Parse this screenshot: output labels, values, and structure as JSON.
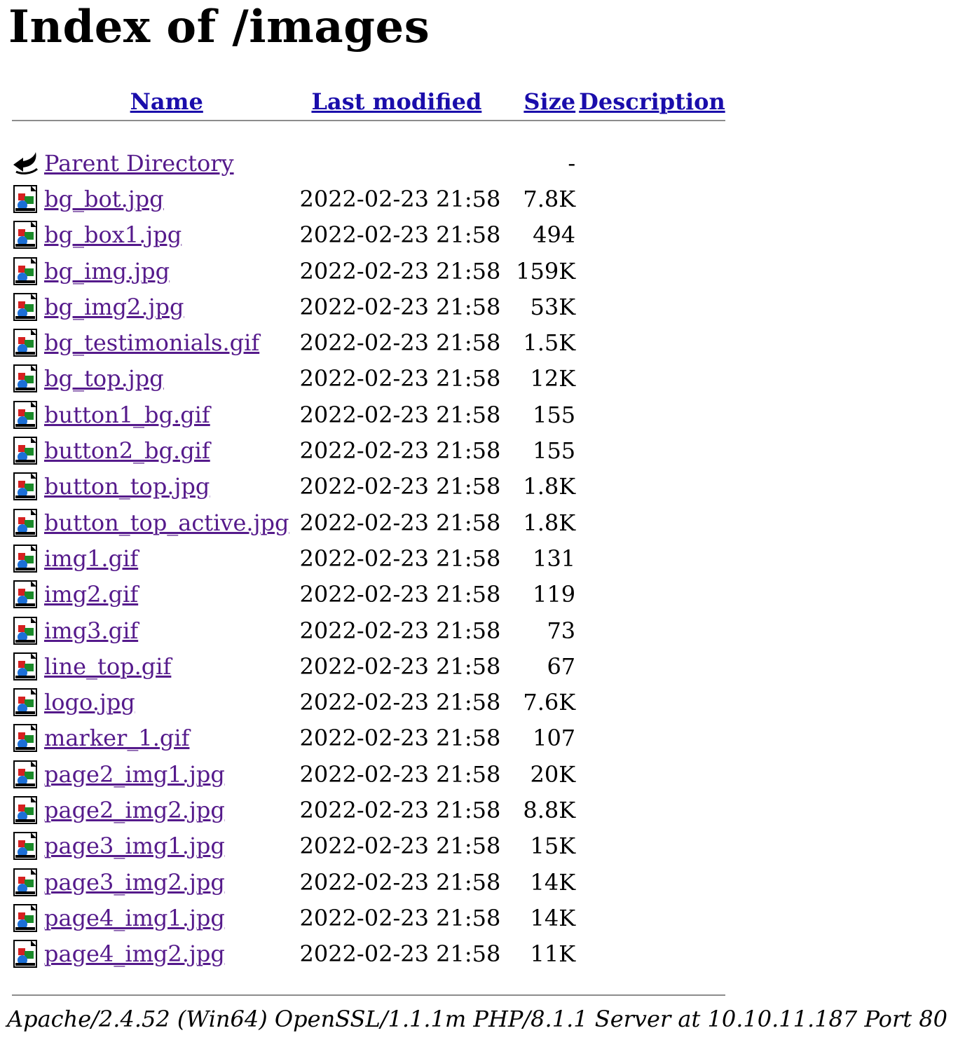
{
  "page": {
    "title": "Index of /images"
  },
  "columns": {
    "name": "Name",
    "last_modified": "Last modified",
    "size": "Size",
    "description": "Description"
  },
  "parent": {
    "label": "Parent Directory",
    "size": "-",
    "icon": "back-arrow-icon"
  },
  "files": [
    {
      "name": "bg_bot.jpg",
      "modified": "2022-02-23 21:58",
      "size": "7.8K",
      "icon": "image-file-icon"
    },
    {
      "name": "bg_box1.jpg",
      "modified": "2022-02-23 21:58",
      "size": "494",
      "icon": "image-file-icon"
    },
    {
      "name": "bg_img.jpg",
      "modified": "2022-02-23 21:58",
      "size": "159K",
      "icon": "image-file-icon"
    },
    {
      "name": "bg_img2.jpg",
      "modified": "2022-02-23 21:58",
      "size": "53K",
      "icon": "image-file-icon"
    },
    {
      "name": "bg_testimonials.gif",
      "modified": "2022-02-23 21:58",
      "size": "1.5K",
      "icon": "image-file-icon"
    },
    {
      "name": "bg_top.jpg",
      "modified": "2022-02-23 21:58",
      "size": "12K",
      "icon": "image-file-icon"
    },
    {
      "name": "button1_bg.gif",
      "modified": "2022-02-23 21:58",
      "size": "155",
      "icon": "image-file-icon"
    },
    {
      "name": "button2_bg.gif",
      "modified": "2022-02-23 21:58",
      "size": "155",
      "icon": "image-file-icon"
    },
    {
      "name": "button_top.jpg",
      "modified": "2022-02-23 21:58",
      "size": "1.8K",
      "icon": "image-file-icon"
    },
    {
      "name": "button_top_active.jpg",
      "modified": "2022-02-23 21:58",
      "size": "1.8K",
      "icon": "image-file-icon"
    },
    {
      "name": "img1.gif",
      "modified": "2022-02-23 21:58",
      "size": "131",
      "icon": "image-file-icon"
    },
    {
      "name": "img2.gif",
      "modified": "2022-02-23 21:58",
      "size": "119",
      "icon": "image-file-icon"
    },
    {
      "name": "img3.gif",
      "modified": "2022-02-23 21:58",
      "size": "73",
      "icon": "image-file-icon"
    },
    {
      "name": "line_top.gif",
      "modified": "2022-02-23 21:58",
      "size": "67",
      "icon": "image-file-icon"
    },
    {
      "name": "logo.jpg",
      "modified": "2022-02-23 21:58",
      "size": "7.6K",
      "icon": "image-file-icon"
    },
    {
      "name": "marker_1.gif",
      "modified": "2022-02-23 21:58",
      "size": "107",
      "icon": "image-file-icon"
    },
    {
      "name": "page2_img1.jpg",
      "modified": "2022-02-23 21:58",
      "size": "20K",
      "icon": "image-file-icon"
    },
    {
      "name": "page2_img2.jpg",
      "modified": "2022-02-23 21:58",
      "size": "8.8K",
      "icon": "image-file-icon"
    },
    {
      "name": "page3_img1.jpg",
      "modified": "2022-02-23 21:58",
      "size": "15K",
      "icon": "image-file-icon"
    },
    {
      "name": "page3_img2.jpg",
      "modified": "2022-02-23 21:58",
      "size": "14K",
      "icon": "image-file-icon"
    },
    {
      "name": "page4_img1.jpg",
      "modified": "2022-02-23 21:58",
      "size": "14K",
      "icon": "image-file-icon"
    },
    {
      "name": "page4_img2.jpg",
      "modified": "2022-02-23 21:58",
      "size": "11K",
      "icon": "image-file-icon"
    }
  ],
  "footer": {
    "server_signature": "Apache/2.4.52 (Win64) OpenSSL/1.1.1m PHP/8.1.1 Server at 10.10.11.187 Port 80"
  },
  "colors": {
    "link": "#1a0dab",
    "visited_link": "#551a8b",
    "rule": "#8c8c8c"
  }
}
